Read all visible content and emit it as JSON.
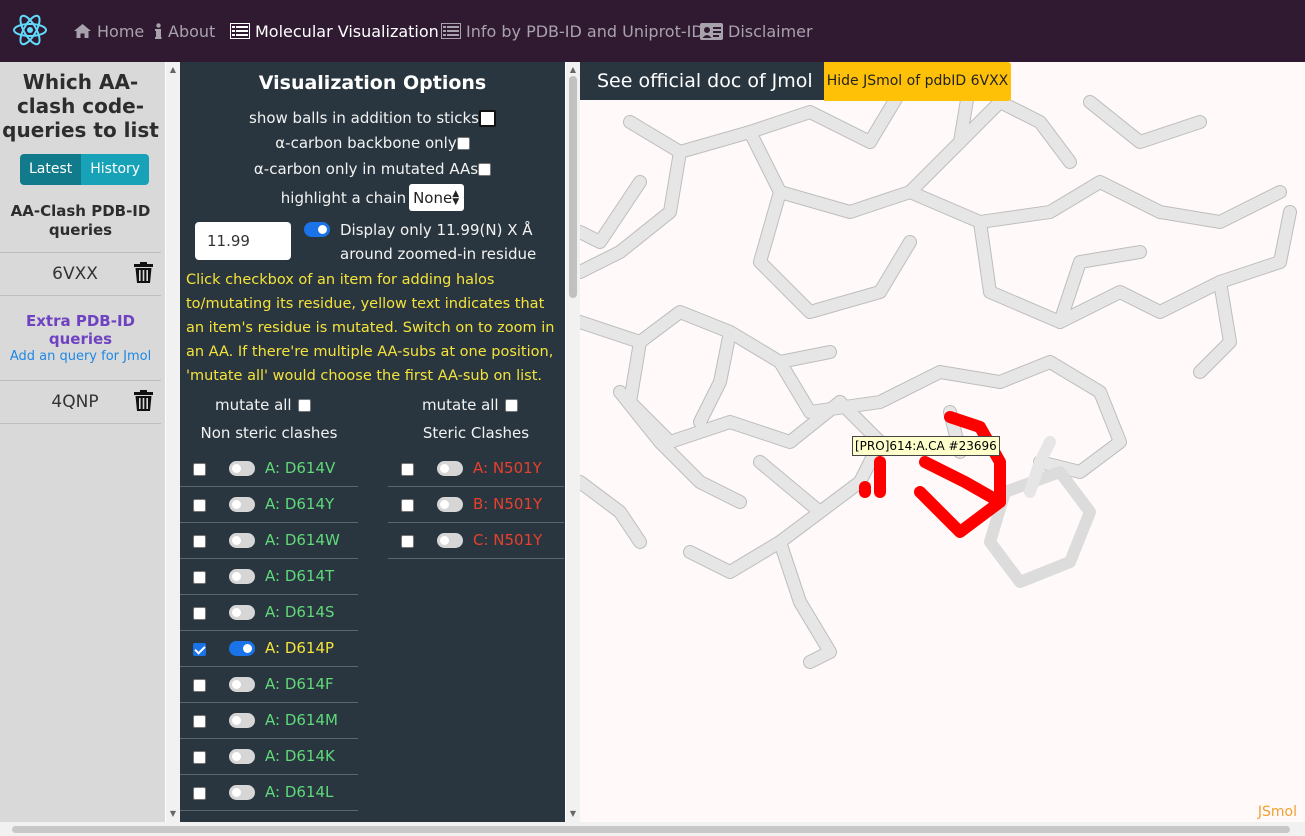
{
  "nav": {
    "items": [
      {
        "label": "Home",
        "icon": "home-icon"
      },
      {
        "label": "About",
        "icon": "info-icon"
      },
      {
        "label": "Molecular Visualization",
        "icon": "list-icon"
      },
      {
        "label": "Info by PDB-ID and Uniprot-ID",
        "icon": "list-icon"
      },
      {
        "label": "Disclaimer",
        "icon": "id-card-icon"
      }
    ],
    "active": "Molecular Visualization"
  },
  "sidebar": {
    "heading": "Which AA-clash code-queries to list",
    "tabs": [
      "Latest",
      "History"
    ],
    "pdb_heading": "AA-Clash PDB-ID queries",
    "pdb_queries": [
      "6VXX"
    ],
    "extra_heading": "Extra PDB-ID queries",
    "add_link": "Add an query for Jmol",
    "extra_queries": [
      "4QNP"
    ]
  },
  "options": {
    "title": "Visualization Options",
    "show_balls": "show balls in addition to sticks",
    "alpha_backbone": "α-carbon backbone only",
    "alpha_mutated": "α-carbon only in mutated AAs",
    "highlight_chain": "highlight a chain",
    "chain_value": "None",
    "distance_value": "11.99",
    "zoom_text_1": "Display only 11.99(N) X Å",
    "zoom_text_2": "around zoomed-in residue",
    "help": "Click checkbox of an item for adding halos to/mutating its residue, yellow text indicates that an item's residue is mutated. Switch on to zoom in an AA. If there're multiple AA-subs at one position, 'mutate all' would choose the first AA-sub on list.",
    "mutate_all": "mutate all",
    "non_steric_title": "Non steric clashes",
    "steric_title": "Steric Clashes",
    "non_steric": [
      {
        "label": "A: D614V",
        "checked": false,
        "zoom": false
      },
      {
        "label": "A: D614Y",
        "checked": false,
        "zoom": false
      },
      {
        "label": "A: D614W",
        "checked": false,
        "zoom": false
      },
      {
        "label": "A: D614T",
        "checked": false,
        "zoom": false
      },
      {
        "label": "A: D614S",
        "checked": false,
        "zoom": false
      },
      {
        "label": "A: D614P",
        "checked": true,
        "zoom": true
      },
      {
        "label": "A: D614F",
        "checked": false,
        "zoom": false
      },
      {
        "label": "A: D614M",
        "checked": false,
        "zoom": false
      },
      {
        "label": "A: D614K",
        "checked": false,
        "zoom": false
      },
      {
        "label": "A: D614L",
        "checked": false,
        "zoom": false
      }
    ],
    "steric": [
      {
        "label": "A: N501Y",
        "checked": false,
        "zoom": false
      },
      {
        "label": "B: N501Y",
        "checked": false,
        "zoom": false
      },
      {
        "label": "C: N501Y",
        "checked": false,
        "zoom": false
      }
    ]
  },
  "jsmol": {
    "doc_button": "See official doc of Jmol",
    "hide_button": "Hide JSmol of pdbID 6VXX",
    "tooltip": "[PRO]614:A.CA #23696",
    "watermark": "JSmol"
  },
  "colors": {
    "nav_bg": "#301a31",
    "panel_bg": "#29363f",
    "non_steric_label": "#5fd97a",
    "mutated_label": "#f5e33b",
    "steric_label": "#e8402c",
    "highlight_residue": "#ff0000"
  }
}
